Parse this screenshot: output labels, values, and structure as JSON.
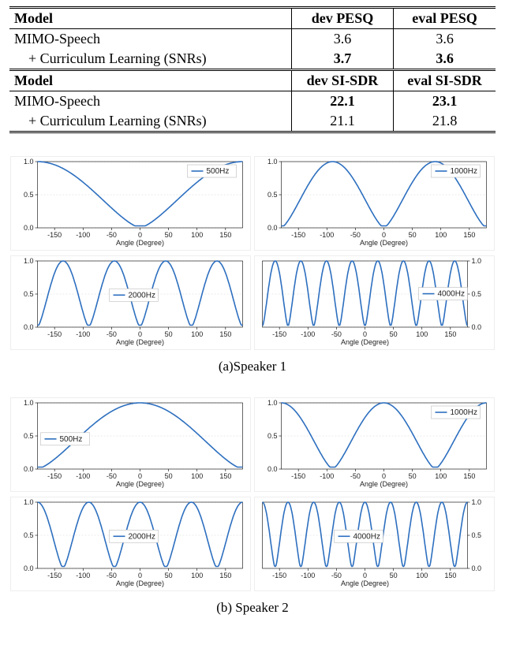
{
  "table": {
    "h1": {
      "c0": "Model",
      "c1": "dev PESQ",
      "c2": "eval PESQ"
    },
    "r1": {
      "c0": "MIMO-Speech",
      "c1": "3.6",
      "c2": "3.6"
    },
    "r2": {
      "c0": "+ Curriculum Learning (SNRs)",
      "c1": "3.7",
      "c2": "3.6"
    },
    "h2": {
      "c0": "Model",
      "c1": "dev SI-SDR",
      "c2": "eval SI-SDR"
    },
    "r3": {
      "c0": "MIMO-Speech",
      "c1": "22.1",
      "c2": "23.1"
    },
    "r4": {
      "c0": "+ Curriculum Learning (SNRs)",
      "c1": "21.1",
      "c2": "21.8"
    }
  },
  "captions": {
    "a": "(a)Speaker 1",
    "b": "(b) Speaker 2"
  },
  "chart_data": [
    {
      "group": "Speaker 1",
      "panels": [
        {
          "freq_label": "500Hz",
          "phase_shift_deg": 180,
          "type": "beampattern",
          "xlabel": "Angle (Degree)",
          "ylim": [
            0,
            1
          ],
          "xlim": [
            -180,
            180
          ],
          "xticks": [
            -150,
            -100,
            -50,
            0,
            50,
            100,
            150
          ],
          "yticks": [
            0.0,
            0.5,
            1.0
          ],
          "cycles": 1,
          "yaxis_side": "left",
          "legend_pos": "top-right"
        },
        {
          "freq_label": "1000Hz",
          "phase_shift_deg": 180,
          "type": "beampattern",
          "xlabel": "Angle (Degree)",
          "ylim": [
            0,
            1
          ],
          "xlim": [
            -180,
            180
          ],
          "xticks": [
            -150,
            -100,
            -50,
            0,
            50,
            100,
            150
          ],
          "yticks": [
            0.0,
            0.5,
            1.0
          ],
          "cycles": 2,
          "yaxis_side": "left",
          "legend_pos": "top-right"
        },
        {
          "freq_label": "2000Hz",
          "phase_shift_deg": 180,
          "type": "beampattern",
          "xlabel": "Angle (Degree)",
          "ylim": [
            0,
            1
          ],
          "xlim": [
            -180,
            180
          ],
          "xticks": [
            -150,
            -100,
            -50,
            0,
            50,
            100,
            150
          ],
          "yticks": [
            0.0,
            0.5,
            1.0
          ],
          "cycles": 4,
          "yaxis_side": "left",
          "legend_pos": "center"
        },
        {
          "freq_label": "4000Hz",
          "phase_shift_deg": 180,
          "type": "beampattern",
          "xlabel": "Angle (Degree)",
          "ylim": [
            0,
            1
          ],
          "xlim": [
            -180,
            180
          ],
          "xticks": [
            -150,
            -100,
            -50,
            0,
            50,
            100,
            150
          ],
          "yticks": [
            0.0,
            0.5,
            1.0
          ],
          "cycles": 8,
          "yaxis_side": "right",
          "legend_pos": "right"
        }
      ]
    },
    {
      "group": "Speaker 2",
      "panels": [
        {
          "freq_label": "500Hz",
          "phase_shift_deg": 0,
          "type": "beampattern",
          "xlabel": "Angle (Degree)",
          "ylim": [
            0,
            1
          ],
          "xlim": [
            -180,
            180
          ],
          "xticks": [
            -150,
            -100,
            -50,
            0,
            50,
            100,
            150
          ],
          "yticks": [
            0.0,
            0.5,
            1.0
          ],
          "cycles": 1,
          "yaxis_side": "left",
          "legend_pos": "left"
        },
        {
          "freq_label": "1000Hz",
          "phase_shift_deg": 0,
          "type": "beampattern",
          "xlabel": "Angle (Degree)",
          "ylim": [
            0,
            1
          ],
          "xlim": [
            -180,
            180
          ],
          "xticks": [
            -150,
            -100,
            -50,
            0,
            50,
            100,
            150
          ],
          "yticks": [
            0.0,
            0.5,
            1.0
          ],
          "cycles": 2,
          "yaxis_side": "left",
          "legend_pos": "top-right"
        },
        {
          "freq_label": "2000Hz",
          "phase_shift_deg": 0,
          "type": "beampattern",
          "xlabel": "Angle (Degree)",
          "ylim": [
            0,
            1
          ],
          "xlim": [
            -180,
            180
          ],
          "xticks": [
            -150,
            -100,
            -50,
            0,
            50,
            100,
            150
          ],
          "yticks": [
            0.0,
            0.5,
            1.0
          ],
          "cycles": 4,
          "yaxis_side": "left",
          "legend_pos": "center"
        },
        {
          "freq_label": "4000Hz",
          "phase_shift_deg": 0,
          "type": "beampattern",
          "xlabel": "Angle (Degree)",
          "ylim": [
            0,
            1
          ],
          "xlim": [
            -180,
            180
          ],
          "xticks": [
            -150,
            -100,
            -50,
            0,
            50,
            100,
            150
          ],
          "yticks": [
            0.0,
            0.5,
            1.0
          ],
          "cycles": 8,
          "yaxis_side": "right",
          "legend_pos": "center"
        }
      ]
    }
  ]
}
